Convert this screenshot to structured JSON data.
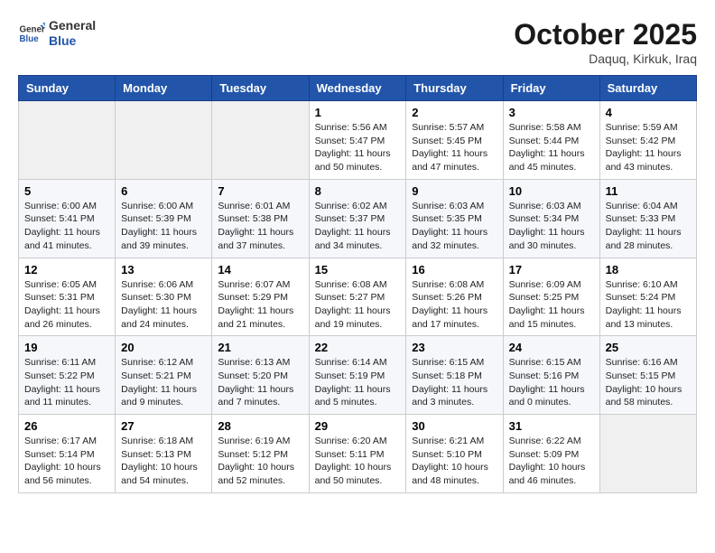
{
  "header": {
    "logo_line1": "General",
    "logo_line2": "Blue",
    "month": "October 2025",
    "location": "Daquq, Kirkuk, Iraq"
  },
  "weekdays": [
    "Sunday",
    "Monday",
    "Tuesday",
    "Wednesday",
    "Thursday",
    "Friday",
    "Saturday"
  ],
  "weeks": [
    [
      {
        "day": "",
        "info": ""
      },
      {
        "day": "",
        "info": ""
      },
      {
        "day": "",
        "info": ""
      },
      {
        "day": "1",
        "info": "Sunrise: 5:56 AM\nSunset: 5:47 PM\nDaylight: 11 hours\nand 50 minutes."
      },
      {
        "day": "2",
        "info": "Sunrise: 5:57 AM\nSunset: 5:45 PM\nDaylight: 11 hours\nand 47 minutes."
      },
      {
        "day": "3",
        "info": "Sunrise: 5:58 AM\nSunset: 5:44 PM\nDaylight: 11 hours\nand 45 minutes."
      },
      {
        "day": "4",
        "info": "Sunrise: 5:59 AM\nSunset: 5:42 PM\nDaylight: 11 hours\nand 43 minutes."
      }
    ],
    [
      {
        "day": "5",
        "info": "Sunrise: 6:00 AM\nSunset: 5:41 PM\nDaylight: 11 hours\nand 41 minutes."
      },
      {
        "day": "6",
        "info": "Sunrise: 6:00 AM\nSunset: 5:39 PM\nDaylight: 11 hours\nand 39 minutes."
      },
      {
        "day": "7",
        "info": "Sunrise: 6:01 AM\nSunset: 5:38 PM\nDaylight: 11 hours\nand 37 minutes."
      },
      {
        "day": "8",
        "info": "Sunrise: 6:02 AM\nSunset: 5:37 PM\nDaylight: 11 hours\nand 34 minutes."
      },
      {
        "day": "9",
        "info": "Sunrise: 6:03 AM\nSunset: 5:35 PM\nDaylight: 11 hours\nand 32 minutes."
      },
      {
        "day": "10",
        "info": "Sunrise: 6:03 AM\nSunset: 5:34 PM\nDaylight: 11 hours\nand 30 minutes."
      },
      {
        "day": "11",
        "info": "Sunrise: 6:04 AM\nSunset: 5:33 PM\nDaylight: 11 hours\nand 28 minutes."
      }
    ],
    [
      {
        "day": "12",
        "info": "Sunrise: 6:05 AM\nSunset: 5:31 PM\nDaylight: 11 hours\nand 26 minutes."
      },
      {
        "day": "13",
        "info": "Sunrise: 6:06 AM\nSunset: 5:30 PM\nDaylight: 11 hours\nand 24 minutes."
      },
      {
        "day": "14",
        "info": "Sunrise: 6:07 AM\nSunset: 5:29 PM\nDaylight: 11 hours\nand 21 minutes."
      },
      {
        "day": "15",
        "info": "Sunrise: 6:08 AM\nSunset: 5:27 PM\nDaylight: 11 hours\nand 19 minutes."
      },
      {
        "day": "16",
        "info": "Sunrise: 6:08 AM\nSunset: 5:26 PM\nDaylight: 11 hours\nand 17 minutes."
      },
      {
        "day": "17",
        "info": "Sunrise: 6:09 AM\nSunset: 5:25 PM\nDaylight: 11 hours\nand 15 minutes."
      },
      {
        "day": "18",
        "info": "Sunrise: 6:10 AM\nSunset: 5:24 PM\nDaylight: 11 hours\nand 13 minutes."
      }
    ],
    [
      {
        "day": "19",
        "info": "Sunrise: 6:11 AM\nSunset: 5:22 PM\nDaylight: 11 hours\nand 11 minutes."
      },
      {
        "day": "20",
        "info": "Sunrise: 6:12 AM\nSunset: 5:21 PM\nDaylight: 11 hours\nand 9 minutes."
      },
      {
        "day": "21",
        "info": "Sunrise: 6:13 AM\nSunset: 5:20 PM\nDaylight: 11 hours\nand 7 minutes."
      },
      {
        "day": "22",
        "info": "Sunrise: 6:14 AM\nSunset: 5:19 PM\nDaylight: 11 hours\nand 5 minutes."
      },
      {
        "day": "23",
        "info": "Sunrise: 6:15 AM\nSunset: 5:18 PM\nDaylight: 11 hours\nand 3 minutes."
      },
      {
        "day": "24",
        "info": "Sunrise: 6:15 AM\nSunset: 5:16 PM\nDaylight: 11 hours\nand 0 minutes."
      },
      {
        "day": "25",
        "info": "Sunrise: 6:16 AM\nSunset: 5:15 PM\nDaylight: 10 hours\nand 58 minutes."
      }
    ],
    [
      {
        "day": "26",
        "info": "Sunrise: 6:17 AM\nSunset: 5:14 PM\nDaylight: 10 hours\nand 56 minutes."
      },
      {
        "day": "27",
        "info": "Sunrise: 6:18 AM\nSunset: 5:13 PM\nDaylight: 10 hours\nand 54 minutes."
      },
      {
        "day": "28",
        "info": "Sunrise: 6:19 AM\nSunset: 5:12 PM\nDaylight: 10 hours\nand 52 minutes."
      },
      {
        "day": "29",
        "info": "Sunrise: 6:20 AM\nSunset: 5:11 PM\nDaylight: 10 hours\nand 50 minutes."
      },
      {
        "day": "30",
        "info": "Sunrise: 6:21 AM\nSunset: 5:10 PM\nDaylight: 10 hours\nand 48 minutes."
      },
      {
        "day": "31",
        "info": "Sunrise: 6:22 AM\nSunset: 5:09 PM\nDaylight: 10 hours\nand 46 minutes."
      },
      {
        "day": "",
        "info": ""
      }
    ]
  ]
}
